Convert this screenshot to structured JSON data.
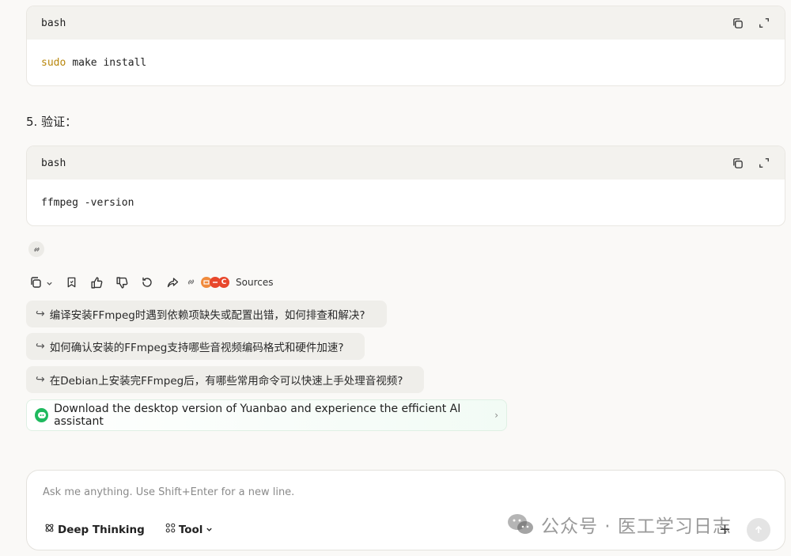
{
  "code_blocks": [
    {
      "lang": "bash",
      "command_keyword": "sudo",
      "command_rest": "make install"
    },
    {
      "lang": "bash",
      "command_keyword": "",
      "command_rest": "ffmpeg -version"
    }
  ],
  "step_heading": "5. 验证：",
  "actions": {
    "sources_label": "Sources",
    "source_logo_letter": "C"
  },
  "suggestions": [
    "编译安装FFmpeg时遇到依赖项缺失或配置出错，如何排查和解决?",
    "如何确认安装的FFmpeg支持哪些音视频编码格式和硬件加速?",
    "在Debian上安装完FFmpeg后，有哪些常用命令可以快速上手处理音视频?"
  ],
  "suggestion_arrow": "↪",
  "promo": {
    "text": "Download the desktop version of Yuanbao and experience the efficient AI assistant",
    "chevron": "›"
  },
  "composer": {
    "placeholder": "Ask me anything. Use Shift+Enter for a new line.",
    "deep_thinking_label": "Deep Thinking",
    "tool_label": "Tool",
    "plus": "+"
  },
  "watermark": {
    "text": "公众号 · 医工学习日志"
  },
  "colors": {
    "keyword": "#b8860b",
    "promo_logo": "#1fb95e",
    "source_red": "#e8472c"
  }
}
